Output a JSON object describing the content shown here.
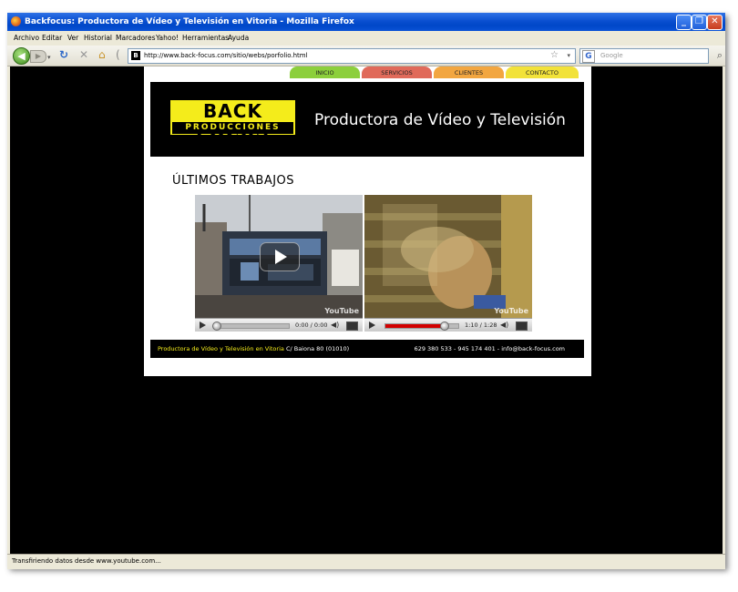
{
  "window": {
    "title": "Backfocus: Productora de Vídeo y Televisión en Vitoria - Mozilla Firefox"
  },
  "menu": [
    "Archivo",
    "Editar",
    "Ver",
    "Historial",
    "Marcadores",
    "Yahoo!",
    "Herramientas",
    "Ayuda"
  ],
  "toolbar": {
    "url": "http://www.back-focus.com/sitio/webs/porfolio.html",
    "search_placeholder": "Google",
    "favicon_letter": "B",
    "search_engine_letter": "G"
  },
  "site": {
    "tabs": [
      {
        "label": "INICIO",
        "color": "#8ccf3c"
      },
      {
        "label": "SERVICIOS",
        "color": "#e06a5a"
      },
      {
        "label": "CLIENTES",
        "color": "#f2a640"
      },
      {
        "label": "CONTACTO",
        "color": "#f2e23a"
      }
    ],
    "logo_top": "BACK FOCUS",
    "logo_bottom": "PRODUCCIONES",
    "header_title": "Productora de Vídeo y Televisión",
    "section_title": "ÚLTIMOS TRABAJOS",
    "videos": [
      {
        "time": "0:00 / 0:00",
        "progress": 0.0,
        "watermark": "YouTube"
      },
      {
        "time": "1:10 / 1:28",
        "progress": 0.8,
        "watermark": "YouTube"
      }
    ],
    "footer": {
      "highlight": "Productora de Vídeo y Televisión en Vitoria",
      "address": " C/ Baiona 80 (01010)",
      "contact": "629 380 533 - 945 174 401 - info@back-focus.com",
      "highlight_color": "#f4ec1b"
    }
  },
  "status": {
    "text": "Transfiriendo datos desde www.youtube.com..."
  }
}
